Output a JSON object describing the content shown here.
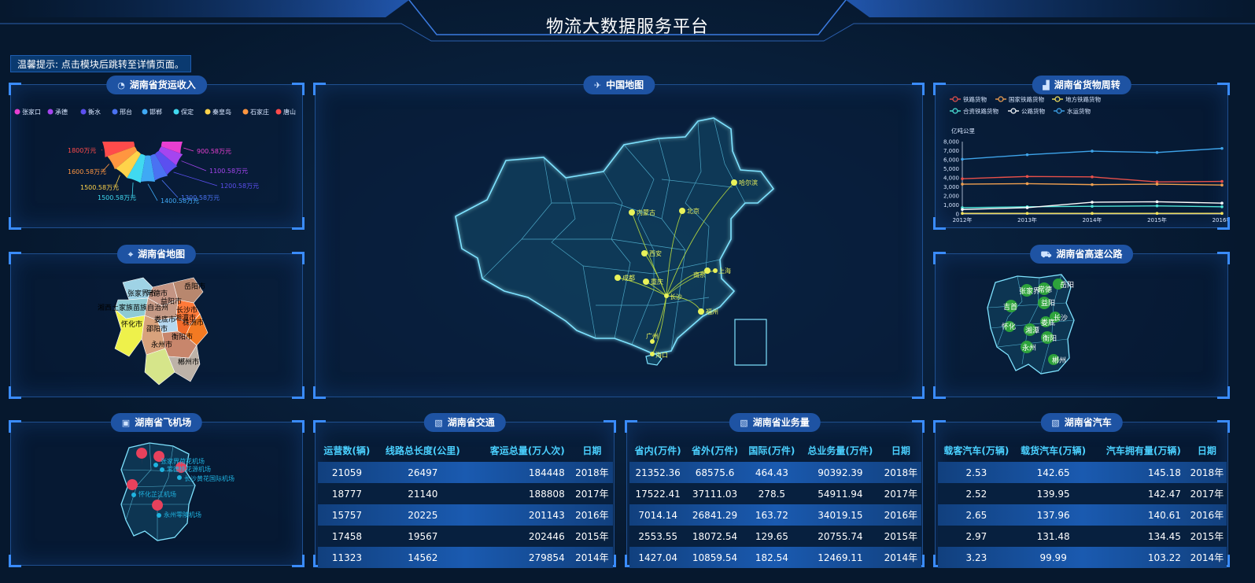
{
  "header": {
    "title": "物流大数据服务平台"
  },
  "tip": "温馨提示: 点击模块后跳转至详情页面。",
  "panels": {
    "freight_income": {
      "title": "湖南省货运收入"
    },
    "china_map": {
      "title": "中国地图"
    },
    "goods_turnover": {
      "title": "湖南省货物周转"
    },
    "hunan_map": {
      "title": "湖南省地图"
    },
    "highway": {
      "title": "湖南省高速公路"
    },
    "airport": {
      "title": "湖南省飞机场"
    },
    "traffic": {
      "title": "湖南省交通"
    },
    "business": {
      "title": "湖南省业务量"
    },
    "cars": {
      "title": "湖南省汽车"
    }
  },
  "chart_data": [
    {
      "type": "pie",
      "legend": [
        "张家口",
        "承德",
        "衡水",
        "邢台",
        "邯郸",
        "保定",
        "秦皇岛",
        "石家庄",
        "唐山"
      ],
      "legend_colors": [
        "#e83fd0",
        "#a545ef",
        "#5b4ff0",
        "#4a72f2",
        "#3fa9f5",
        "#40d9f0",
        "#ffd34a",
        "#ff9640",
        "#ff4b4b"
      ],
      "slices": [
        {
          "label": "1800万元",
          "value": 1800,
          "color": "#ff4b4b"
        },
        {
          "label": "1600.58万元",
          "value": 1600.58,
          "color": "#ff9640"
        },
        {
          "label": "1500.58万元",
          "value": 1500.58,
          "color": "#ffd34a"
        },
        {
          "label": "1500.58万元",
          "value": 1500.58,
          "color": "#40d9f0"
        },
        {
          "label": "1400.58万元",
          "value": 1400.58,
          "color": "#3fa9f5"
        },
        {
          "label": "1300.58万元",
          "value": 1300.58,
          "color": "#4a72f2"
        },
        {
          "label": "1200.58万元",
          "value": 1200.58,
          "color": "#5b4ff0"
        },
        {
          "label": "1100.58万元",
          "value": 1100.58,
          "color": "#a545ef"
        },
        {
          "label": "900.58万元",
          "value": 900.58,
          "color": "#e83fd0"
        }
      ]
    },
    {
      "type": "line",
      "ylabel": "亿吨公里",
      "x": [
        "2012年",
        "2013年",
        "2014年",
        "2015年",
        "2016年"
      ],
      "yticks": [
        "0",
        "1,000",
        "2,000",
        "3,000",
        "4,000",
        "5,000",
        "6,000",
        "7,000",
        "8,000"
      ],
      "ylim": [
        0,
        8000
      ],
      "legend": [
        "铁路货物",
        "国家铁路货物",
        "地方铁路货物",
        "合资铁路货物",
        "公路货物",
        "水运货物"
      ],
      "series": [
        {
          "name": "铁路货物",
          "color": "#e8504a",
          "values": [
            3900,
            4150,
            4100,
            3550,
            3600
          ]
        },
        {
          "name": "国家铁路货物",
          "color": "#f0a050",
          "values": [
            3300,
            3350,
            3250,
            3300,
            3200
          ]
        },
        {
          "name": "地方铁路货物",
          "color": "#f7e45c",
          "values": [
            70,
            70,
            70,
            70,
            70
          ]
        },
        {
          "name": "合资铁路货物",
          "color": "#4ee6d8",
          "values": [
            700,
            800,
            850,
            900,
            800
          ]
        },
        {
          "name": "公路货物",
          "color": "#ffffff",
          "values": [
            500,
            700,
            1300,
            1350,
            1200
          ]
        },
        {
          "name": "水运货物",
          "color": "#3ea4ea",
          "values": [
            6050,
            6550,
            6950,
            6800,
            7250
          ]
        }
      ]
    },
    {
      "type": "table",
      "columns": [
        "运营数(辆)",
        "线路总长度(公里)",
        "客运总量(万人次)",
        "日期"
      ],
      "rows": [
        [
          "21059",
          "26497",
          "184448",
          "2018年"
        ],
        [
          "18777",
          "21140",
          "188808",
          "2017年"
        ],
        [
          "15757",
          "20225",
          "201143",
          "2016年"
        ],
        [
          "17458",
          "19567",
          "202446",
          "2015年"
        ],
        [
          "11323",
          "14562",
          "279854",
          "2014年"
        ]
      ]
    },
    {
      "type": "table",
      "columns": [
        "省内(万件)",
        "省外(万件)",
        "国际(万件)",
        "总业务量(万件)",
        "日期"
      ],
      "rows": [
        [
          "21352.36",
          "68575.6",
          "464.43",
          "90392.39",
          "2018年"
        ],
        [
          "17522.41",
          "37111.03",
          "278.5",
          "54911.94",
          "2017年"
        ],
        [
          "7014.14",
          "26841.29",
          "163.72",
          "34019.15",
          "2016年"
        ],
        [
          "2553.55",
          "18072.54",
          "129.65",
          "20755.74",
          "2015年"
        ],
        [
          "1427.04",
          "10859.54",
          "182.54",
          "12469.11",
          "2014年"
        ]
      ]
    },
    {
      "type": "table",
      "columns": [
        "载客汽车(万辆)",
        "载货汽车(万辆)",
        "汽车拥有量(万辆)",
        "日期"
      ],
      "rows": [
        [
          "2.53",
          "142.65",
          "145.18",
          "2018年"
        ],
        [
          "2.52",
          "139.95",
          "142.47",
          "2017年"
        ],
        [
          "2.65",
          "137.96",
          "140.61",
          "2016年"
        ],
        [
          "2.97",
          "131.48",
          "134.45",
          "2015年"
        ],
        [
          "3.23",
          "99.99",
          "103.22",
          "2014年"
        ]
      ]
    }
  ],
  "china_cities": [
    "哈尔滨",
    "北京",
    "内蒙古",
    "西安",
    "成都",
    "重庆",
    "南京",
    "上海",
    "福州",
    "广州",
    "海口",
    "长沙"
  ],
  "hunan_cities": [
    "岳阳市",
    "张家界市",
    "常德市",
    "益阳市",
    "湘西土家族苗族自治州",
    "长沙市",
    "娄底市",
    "湘潭市",
    "怀化市",
    "邵阳市",
    "株洲市",
    "衡阳市",
    "永州市",
    "郴州市"
  ],
  "highway_cities": [
    "张家界",
    "常德",
    "岳阳",
    "益阳",
    "吉首",
    "长沙",
    "怀化",
    "湘潭",
    "娄底",
    "衡阳",
    "永州",
    "郴州"
  ],
  "airports": [
    "张家界荷花机场",
    "常德桃花源机场",
    "长沙黄花国际机场",
    "怀化芷江机场",
    "永州零陵机场"
  ]
}
